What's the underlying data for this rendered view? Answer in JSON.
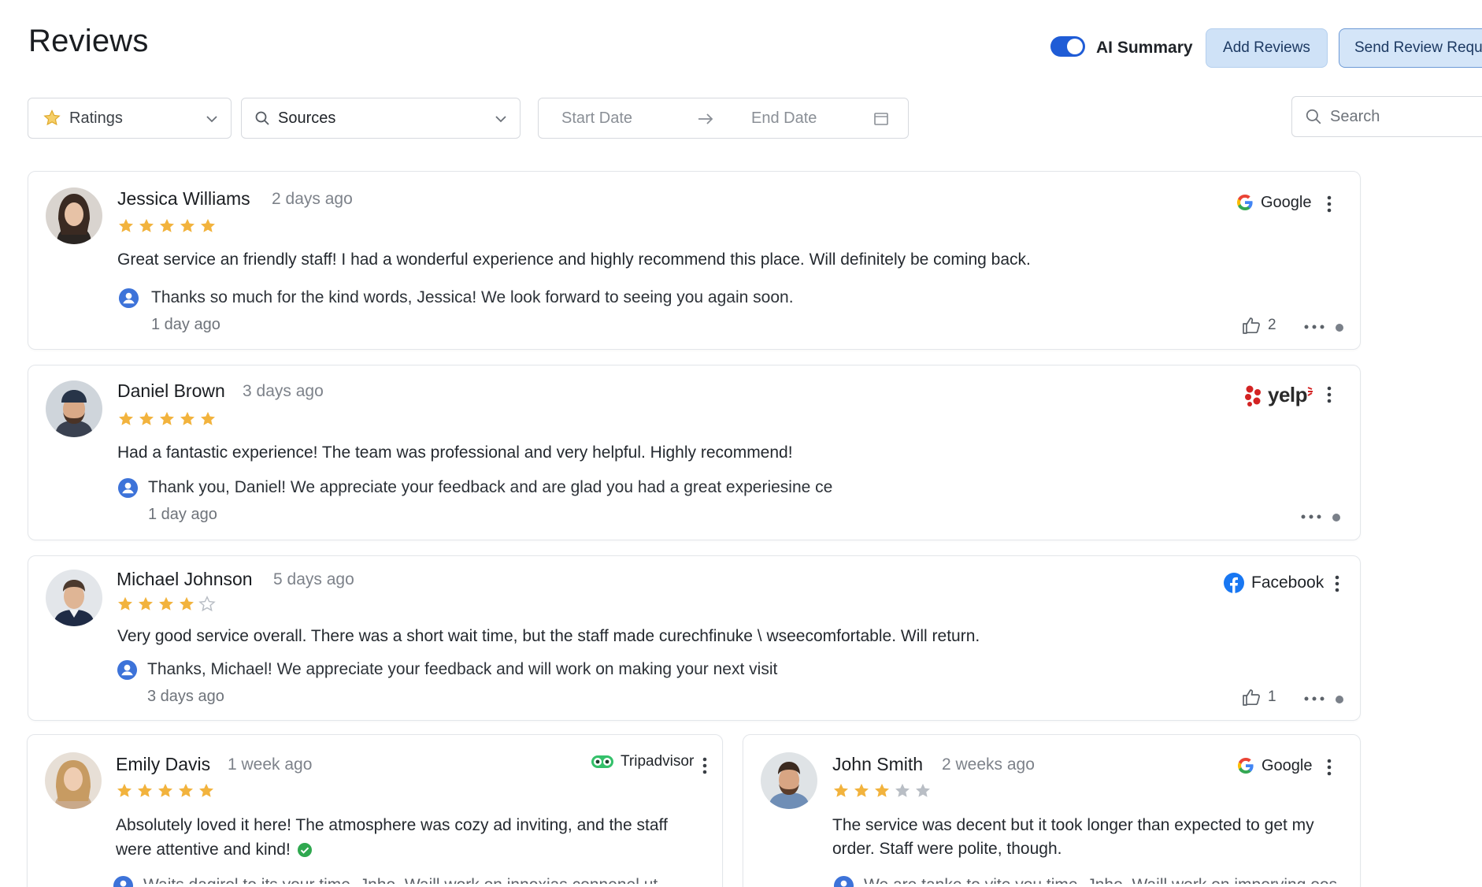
{
  "page": {
    "title": "Reviews"
  },
  "header": {
    "ai_summary_label": "AI Summary",
    "ai_summary_on": true,
    "add_reviews_label": "Add Reviews",
    "send_review_label": "Send Review Requ"
  },
  "filters": {
    "ratings_label": "Ratings",
    "sources_label": "Sources",
    "start_date_placeholder": "Start Date",
    "end_date_placeholder": "End Date",
    "search_placeholder": "Search"
  },
  "colors": {
    "accent": "#1f5cd6",
    "star": "#f2b33d",
    "star_empty": "#b9bec5"
  },
  "reviews": [
    {
      "name": "Jessica Williams",
      "ago": "2 days ago",
      "rating": 5,
      "source": "Google",
      "text": "Great service an friendly staff! I had a wonderful experience and highly recommend this place. Will definitely be coming back.",
      "reply": "Thanks so much for the kind words,  Jessica! We look forward to seeing you again soon.",
      "reply_ago": "1 day ago",
      "likes": "2"
    },
    {
      "name": "Daniel Brown",
      "ago": "3 days ago",
      "rating": 5,
      "source": "yelp",
      "text": "Had a fantastic experience! The team was professional and very helpful. Highly recommend!",
      "reply": "Thank you, Daniel! We appreciate your feedback and are glad you had a great experiesine ce",
      "reply_ago": "1 day ago"
    },
    {
      "name": "Michael Johnson",
      "ago": "5 days ago",
      "rating": 4,
      "source": "Facebook",
      "text": "Very good service overall. There was a short wait time, but the staff made curechfinuke \\ wseecomfortable. Will return.",
      "reply": "Thanks, Michael! We appreciate your feedback and will work on making your next visit",
      "reply_ago": "3 days ago",
      "likes": "1"
    },
    {
      "name": "Emily Davis",
      "ago": "1 week ago",
      "rating": 5,
      "source": "Tripadvisor",
      "text_line1": "Absolutely loved it here! The atmosphere was cozy ad inviting, and the staff",
      "text_line2": "were attentive and kind!",
      "reply_partial": "Waits dagirol to its your time. Jnho. Waill work on innoxias connenel ut"
    },
    {
      "name": "John Smith",
      "ago": "2 weeks ago",
      "rating": 3,
      "source": "Google",
      "text_line1": "The service was decent but it took longer than expected to get my",
      "text_line2": "order. Staff were polite, though.",
      "reply_partial": "We are tanke to vite you time. Jnho. Waill work on imporving oos"
    }
  ]
}
